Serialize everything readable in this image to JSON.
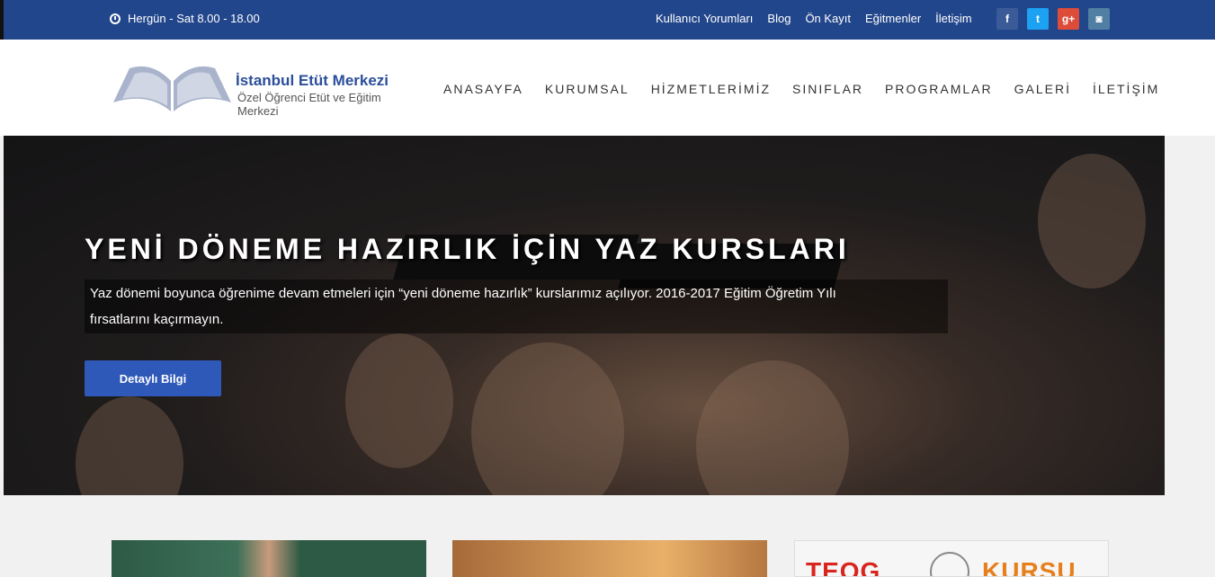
{
  "topbar": {
    "hours": "Hergün - Sat 8.00 - 18.00",
    "links": [
      "Kullanıcı Yorumları",
      "Blog",
      "Ön Kayıt",
      "Eğitmenler",
      "İletişim"
    ],
    "social": {
      "facebook": "f",
      "twitter": "t",
      "googleplus": "g+",
      "instagram": "◙"
    },
    "color": "#22468b"
  },
  "logo": {
    "title": "İstanbul Etüt Merkezi",
    "subtitle": "Özel Öğrenci Etüt ve Eğitim Merkezi"
  },
  "nav": [
    "ANASAYFA",
    "KURUMSAL",
    "HİZMETLERİMİZ",
    "SINIFLAR",
    "PROGRAMLAR",
    "GALERİ",
    "İLETİŞİM"
  ],
  "hero": {
    "title": "YENİ DÖNEME HAZIRLIK İÇİN YAZ KURSLARI",
    "description_line1": "Yaz dönemi boyunca öğrenime devam etmeleri için “yeni döneme hazırlık” kurslarımız açılıyor. 2016-2017 Eğitim Öğretim Yılı",
    "description_line2": "fırsatlarını kaçırmayın.",
    "button": "Detaylı Bilgi",
    "button_color": "#2f59b8"
  },
  "cards": {
    "card3_left": "TEOG",
    "card3_right": "KURSU"
  }
}
